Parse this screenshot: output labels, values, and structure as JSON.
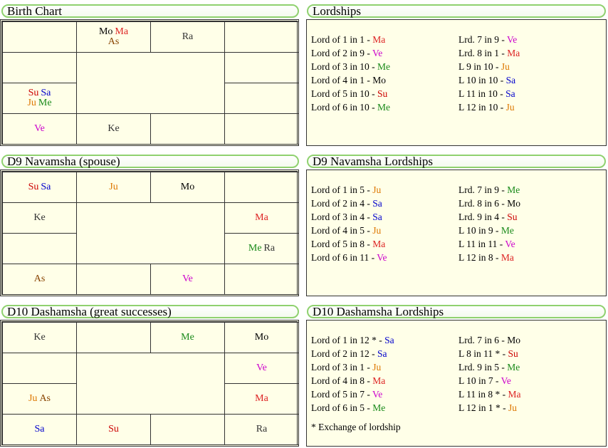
{
  "colors": {
    "Su": "#cc0000",
    "Mo": "#000000",
    "Ma": "#dd2222",
    "Me": "#1a8a1a",
    "Ju": "#dd7700",
    "Ve": "#cc00cc",
    "Sa": "#0000cc",
    "Ra": "#333333",
    "Ke": "#333333",
    "As": "#884400"
  },
  "panels": {
    "birth": {
      "title": "Birth Chart"
    },
    "lord1": {
      "title": "Lordships"
    },
    "d9": {
      "title": "D9 Navamsha  (spouse)"
    },
    "lord9": {
      "title": "D9 Navamsha  Lordships"
    },
    "d10": {
      "title": "D10 Dashamsha  (great successes)"
    },
    "lord10": {
      "title": "D10 Dashamsha  Lordships"
    }
  },
  "charts": {
    "birth": {
      "top": [
        [],
        [
          [
            "Mo",
            "Ma"
          ],
          [
            "As"
          ]
        ],
        [
          [
            "Ra"
          ]
        ],
        []
      ],
      "left": [
        [],
        [
          [
            "Su",
            "Sa"
          ],
          [
            "Ju",
            "Me"
          ]
        ]
      ],
      "right": [
        [],
        []
      ],
      "bottom": [
        [
          [
            "Ve"
          ]
        ],
        [
          [
            "Ke"
          ]
        ],
        [],
        []
      ]
    },
    "d9": {
      "top": [
        [
          [
            "Su",
            "Sa"
          ]
        ],
        [
          [
            "Ju"
          ]
        ],
        [
          [
            "Mo"
          ]
        ],
        []
      ],
      "left": [
        [
          [
            "Ke"
          ]
        ],
        []
      ],
      "right": [
        [
          [
            "Ma"
          ]
        ],
        [
          [
            "Me",
            "Ra"
          ]
        ]
      ],
      "bottom": [
        [
          [
            "As"
          ]
        ],
        [],
        [
          [
            "Ve"
          ]
        ],
        []
      ]
    },
    "d10": {
      "top": [
        [
          [
            "Ke"
          ]
        ],
        [],
        [
          [
            "Me"
          ]
        ],
        [
          [
            "Mo"
          ]
        ]
      ],
      "left": [
        [],
        [
          [
            "Ju",
            "As"
          ]
        ]
      ],
      "right": [
        [
          [
            "Ve"
          ]
        ],
        [
          [
            "Ma"
          ]
        ]
      ],
      "bottom": [
        [
          [
            "Sa"
          ]
        ],
        [
          [
            "Su"
          ]
        ],
        [],
        [
          [
            "Ra"
          ]
        ]
      ]
    }
  },
  "lordships": {
    "birth": {
      "left": [
        [
          "Lord of 1 in 1 - ",
          "Ma"
        ],
        [
          "Lord of 2 in 9 - ",
          "Ve"
        ],
        [
          "Lord of 3 in 10 - ",
          "Me"
        ],
        [
          "Lord of 4 in 1 - ",
          "Mo"
        ],
        [
          "Lord of 5 in 10 - ",
          "Su"
        ],
        [
          "Lord of 6 in 10 - ",
          "Me"
        ]
      ],
      "right": [
        [
          "Lrd. 7 in 9 - ",
          "Ve"
        ],
        [
          "Lrd. 8 in 1 - ",
          "Ma"
        ],
        [
          "L 9 in 10 - ",
          "Ju"
        ],
        [
          "L 10 in 10 - ",
          "Sa"
        ],
        [
          "L 11 in 10 - ",
          "Sa"
        ],
        [
          "L 12 in 10 - ",
          "Ju"
        ]
      ]
    },
    "d9": {
      "left": [
        [
          "Lord of 1 in 5 - ",
          "Ju"
        ],
        [
          "Lord of 2 in 4 - ",
          "Sa"
        ],
        [
          "Lord of 3 in 4 - ",
          "Sa"
        ],
        [
          "Lord of 4 in 5 - ",
          "Ju"
        ],
        [
          "Lord of 5 in 8 - ",
          "Ma"
        ],
        [
          "Lord of 6 in 11 - ",
          "Ve"
        ]
      ],
      "right": [
        [
          "Lrd. 7 in 9 - ",
          "Me"
        ],
        [
          "Lrd. 8 in 6 - ",
          "Mo"
        ],
        [
          "Lrd. 9 in 4 - ",
          "Su"
        ],
        [
          "L 10 in 9 - ",
          "Me"
        ],
        [
          "L 11 in 11 - ",
          "Ve"
        ],
        [
          "L 12 in 8 - ",
          "Ma"
        ]
      ]
    },
    "d10": {
      "left": [
        [
          "Lord of 1 in 12 * - ",
          "Sa"
        ],
        [
          "Lord of 2 in 12 - ",
          "Sa"
        ],
        [
          "Lord of 3 in 1 - ",
          "Ju"
        ],
        [
          "Lord of 4 in 8 - ",
          "Ma"
        ],
        [
          "Lord of 5 in 7 - ",
          "Ve"
        ],
        [
          "Lord of 6 in 5 - ",
          "Me"
        ]
      ],
      "right": [
        [
          "Lrd. 7 in 6 - ",
          "Mo"
        ],
        [
          "L 8 in 11 * - ",
          "Su"
        ],
        [
          "Lrd. 9 in 5 - ",
          "Me"
        ],
        [
          "L 10 in 7 - ",
          "Ve"
        ],
        [
          "L 11 in 8 * - ",
          "Ma"
        ],
        [
          "L 12 in 1 * - ",
          "Ju"
        ]
      ],
      "note": "* Exchange of lordship"
    }
  }
}
